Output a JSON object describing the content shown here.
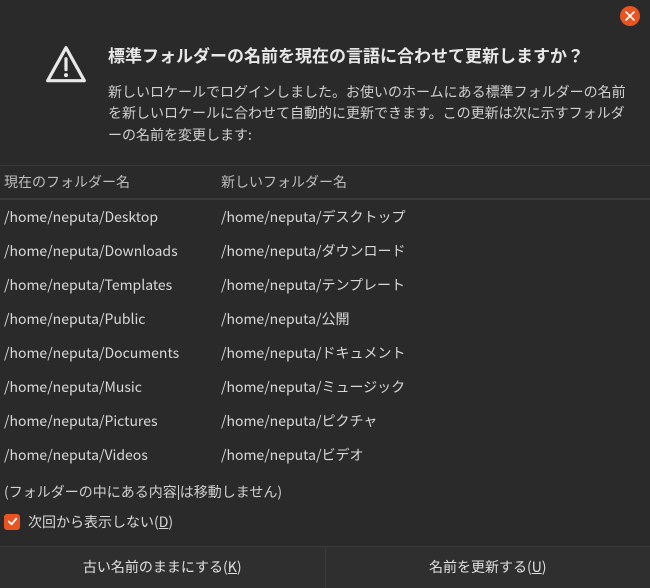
{
  "dialog": {
    "title": "標準フォルダーの名前を現在の言語に合わせて更新しますか？",
    "description": "新しいロケールでログインしました。お使いのホームにある標準フォルダーの名前を新しいロケールに合わせて自動的に更新できます。この更新は次に示すフォルダーの名前を変更します:"
  },
  "table": {
    "header_current": "現在のフォルダー名",
    "header_new": "新しいフォルダー名",
    "rows": [
      {
        "current": "/home/neputa/Desktop",
        "new": "/home/neputa/デスクトップ"
      },
      {
        "current": "/home/neputa/Downloads",
        "new": "/home/neputa/ダウンロード"
      },
      {
        "current": "/home/neputa/Templates",
        "new": "/home/neputa/テンプレート"
      },
      {
        "current": "/home/neputa/Public",
        "new": "/home/neputa/公開"
      },
      {
        "current": "/home/neputa/Documents",
        "new": "/home/neputa/ドキュメント"
      },
      {
        "current": "/home/neputa/Music",
        "new": "/home/neputa/ミュージック"
      },
      {
        "current": "/home/neputa/Pictures",
        "new": "/home/neputa/ピクチャ"
      },
      {
        "current": "/home/neputa/Videos",
        "new": "/home/neputa/ビデオ"
      }
    ]
  },
  "note_before": "(フォルダーの中にある内容",
  "note_after": "は移動しません)",
  "checkbox": {
    "checked": true,
    "label_main": "次回から表示しない(",
    "label_key": "D",
    "label_end": ")"
  },
  "buttons": {
    "keep_main": "古い名前のままにする(",
    "keep_key": "K",
    "keep_end": ")",
    "update_main": "名前を更新する(",
    "update_key": "U",
    "update_end": ")"
  },
  "colors": {
    "accent": "#e95420",
    "bg": "#2a2a2a"
  }
}
